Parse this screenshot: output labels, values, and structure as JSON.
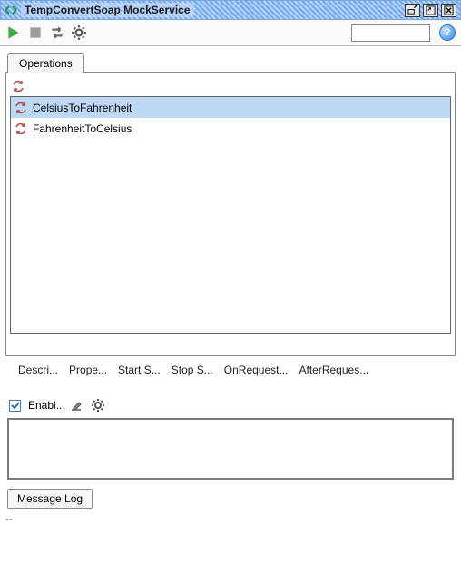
{
  "title": "TempConvertSoap MockService",
  "tabs": {
    "operations": "Operations"
  },
  "operations": {
    "items": [
      {
        "label": "CelsiusToFahrenheit",
        "selected": true
      },
      {
        "label": "FahrenheitToCelsius",
        "selected": false
      }
    ]
  },
  "bottomTabs": {
    "description": "Descri...",
    "properties": "Prope...",
    "startScript": "Start S...",
    "stopScript": "Stop S...",
    "onRequest": "OnRequest...",
    "afterRequest": "AfterReques..."
  },
  "options": {
    "enablLabel": "Enabl.."
  },
  "messageLog": {
    "tabLabel": "Message Log"
  },
  "status": "--"
}
